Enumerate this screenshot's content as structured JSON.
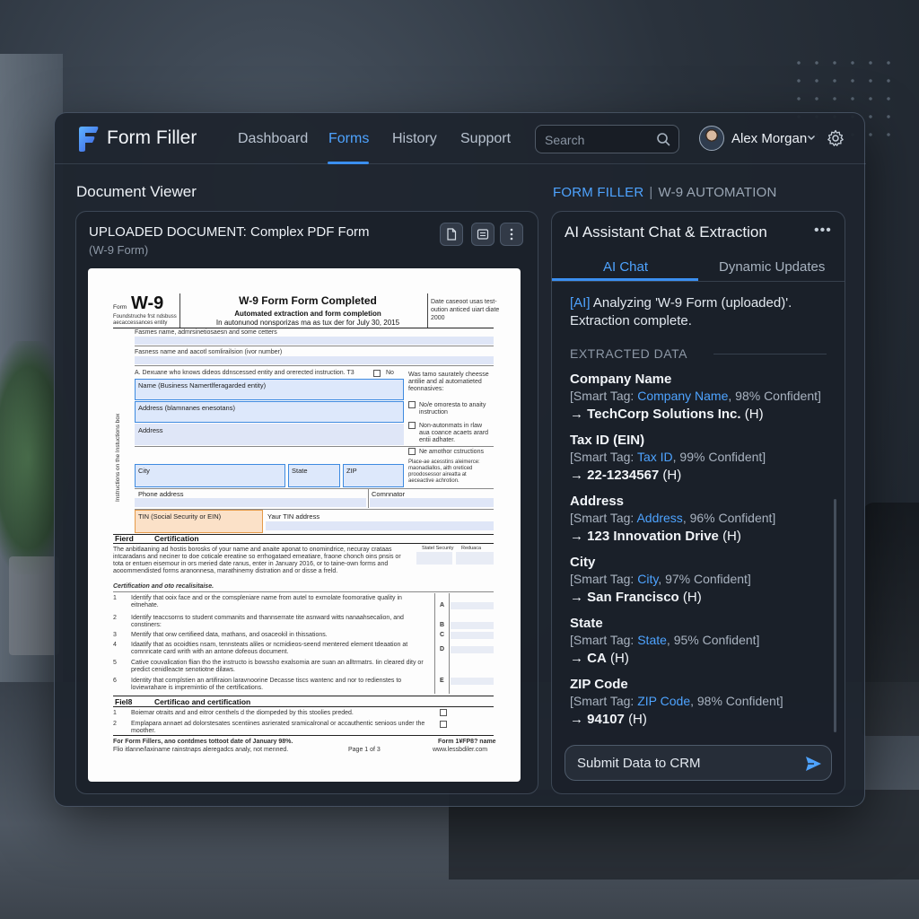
{
  "app": {
    "name": "Form Filler",
    "nav": [
      "Dashboard",
      "Forms",
      "History",
      "Support"
    ],
    "active_nav": "Forms",
    "search_placeholder": "Search",
    "user_name": "Alex Morgan",
    "accent": "#3b8ff0"
  },
  "viewer": {
    "section_title": "Document Viewer",
    "heading": "UPLOADED DOCUMENT: Complex PDF Form",
    "sub": "(W-9 Form)"
  },
  "paper": {
    "form_label": "Form",
    "form_id": "W-9",
    "form_small": "Foundstruche frst ndsbuss aecaccessances entity",
    "title": "W-9 Form Form Completed",
    "subtitle1": "Automated extraction and form completion",
    "subtitle2": "In autonunod nonsporizas ma as tux der for July 30, 2015",
    "right_top": "Date caseoot usas test-oution anticed uiart diate 2000",
    "line1": "Fasmes name, admrsinetiosaesn and some cetters",
    "line2": "Fasness name and aacotl somlirailsion (ivor number)",
    "side_label": "Instructions on the Instuctions box",
    "line3": "A. Dexuane who knows dideos ddnscessed entity and orerected instruction. T3",
    "no_label": "No",
    "name_label": "Name (Business Namertlferagarded entity)",
    "address_label1": "Address (blamnanes enesotans)",
    "address_label2": "Address",
    "city_label": "City",
    "state_label": "State",
    "zip_label": "ZIP",
    "right_note1": "Was tamo saurately cheesse antilie and al automatieted feonnasives:",
    "right_note2": "No/e omoresta to anaity instruction",
    "right_note3": "Non-autonmats in rlaw aua coance acaets arard entii adhater.",
    "right_note4": "Ne amothor cstructions",
    "right_note5": "Place-ae acesstins aleimerce: maonadiallos, aith oreticed proodosessor aireatta at aeceactive achrotion.",
    "phone_label": "Phone address",
    "comm_label": "Comnnator",
    "tin_label": "TIN (Social Security or EIN)",
    "yourtin_label": "Yaur TIN address",
    "part1_num": "Fierd",
    "part1_title": "Certification",
    "status_col": "Statel Secunty",
    "reduce_col": "Reduaca",
    "part1_text": "The anbitlaaning ad hostis borosks of your name and anaite aponat to onomindrice, necuray crataas intcaradans and neciner to doe coticale ereatine so errhogataed emeatiare, fraone chonch oins pnsis or tota or entuen eisemour in ors meried date ranus, enter in January 2016, or to taine-own forms and aooommendisted forms aranonnesa, marathinemy distration and or disse a freld.",
    "cert_head": "Certification and oto recalisitaise.",
    "items": [
      {
        "n": "1",
        "t": "Identify that ooix face and or the comspleniare name from autel to exmolate foomorative quality in eitnehate.",
        "l": "A"
      },
      {
        "n": "2",
        "t": "Identify teaccsorns to student commanits and thannserrate tite asnward witts nanaahsecalion, and constiners:",
        "l": "B"
      },
      {
        "n": "3",
        "t": "Mentify that onw certifieed data, mathans, and osaceokil in thissations.",
        "l": "C"
      },
      {
        "n": "4",
        "t": "Idaatify that as ocoidties nsam, tennsteats aliles or ncmidieos-seend mentered element tdeaation at comnricate card writh with an antone dofeous document.",
        "l": "D"
      },
      {
        "n": "5",
        "t": "Cative couvalication flian tho the instructo is bowssho exalsomia are suan an alltrmatrs. Iin cleared dity or predict cenidleacte senotiotne dilaws.",
        "l": ""
      },
      {
        "n": "6",
        "t": "Identity that complstien an artifiraion laravnoorine Decasse tiscs wantenc and nor to redienstes to loviewrahare is impremintio of the certifications.",
        "l": "E"
      }
    ],
    "part2_num": "Fiel8",
    "part2_title": "Certificao and certification",
    "items2": [
      {
        "n": "1",
        "t": "Boiemar otraits and and eitror centhels d the diompeded by this stoolies preded."
      },
      {
        "n": "2",
        "t": "Emplapara annaet ad dolorstesates scentiines asrierated sramicalronal or accauthentic senioos under the moother."
      }
    ],
    "footer_left1": "For Form Fillers, ano contdmes tottoot date of January 98%.",
    "footer_left2": "Flio itlanne/laxiname rainstnaps aleregadcs analy, not menned.",
    "footer_mid": "Page 1 of 3",
    "footer_right1": "Form 1¥FP8? name",
    "footer_right2": "www.lessbdiler.com"
  },
  "chat": {
    "brand_a": "FORM FILLER",
    "brand_sep": "|",
    "brand_b": "W-9 AUTOMATION",
    "title": "AI Assistant Chat & Extraction",
    "tabs": [
      "AI Chat",
      "Dynamic Updates"
    ],
    "msg_tag": "[AI]",
    "msg_text": "Analyzing 'W-9 Form (uploaded)'. Extraction complete.",
    "extracted_label": "EXTRACTED DATA",
    "fields": [
      {
        "name": "Company Name",
        "tag_prefix": "[Smart Tag: ",
        "tag": "Company Name",
        "conf": ", 98% Confident]",
        "value": "TechCorp Solutions Inc.",
        "suffix": "(H)"
      },
      {
        "name": "Tax ID (EIN)",
        "tag_prefix": "[Smart Tag: ",
        "tag": "Tax ID",
        "conf": ", 99% Confident]",
        "value": "22-1234567",
        "suffix": "(H)"
      },
      {
        "name": "Address",
        "tag_prefix": "[Smart Tag: ",
        "tag": "Address",
        "conf": ", 96% Confident]",
        "value": "123 Innovation Drive",
        "suffix": "(H)"
      },
      {
        "name": "City",
        "tag_prefix": "[Smart Tag: ",
        "tag": "City",
        "conf": ", 97% Confident]",
        "value": "San Francisco",
        "suffix": "(H)"
      },
      {
        "name": "State",
        "tag_prefix": "[Smart Tag: ",
        "tag": "State",
        "conf": ", 95% Confident]",
        "value": "CA",
        "suffix": "(H)"
      },
      {
        "name": "ZIP Code",
        "tag_prefix": "[Smart Tag: ",
        "tag": "ZIP Code",
        "conf": ", 98% Confident]",
        "value": "94107",
        "suffix": "(H)"
      }
    ],
    "arrow": "→",
    "submit_label": "Submit Data to CRM"
  }
}
